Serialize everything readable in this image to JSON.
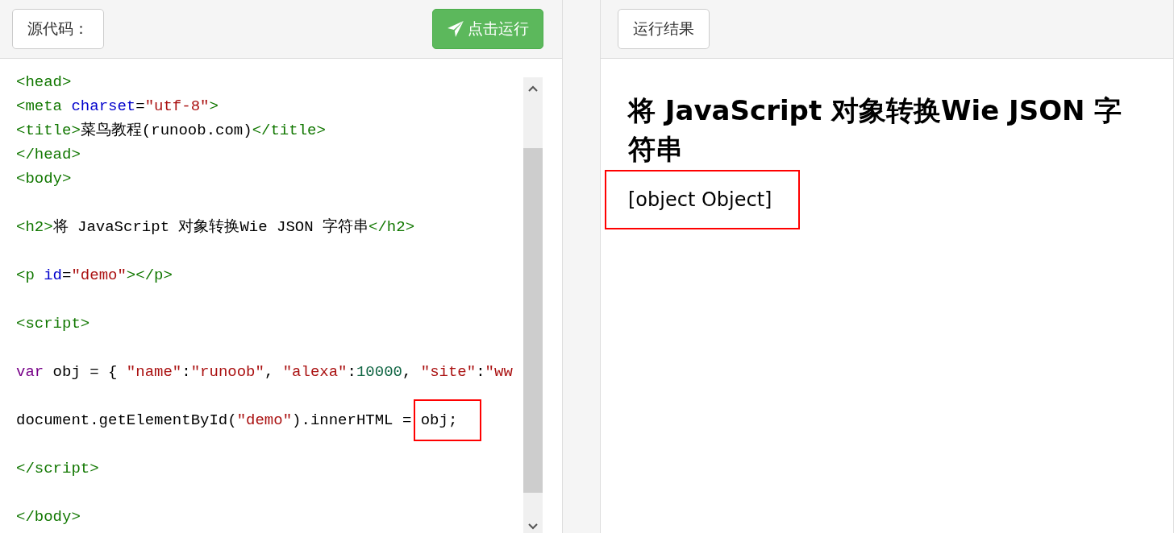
{
  "editor": {
    "label_button": "源代码：",
    "run_button": "点击运行",
    "lines": [
      {
        "kind": "code",
        "tokens": [
          {
            "kind": "tag",
            "text": "<head>"
          }
        ]
      },
      {
        "kind": "code",
        "tokens": [
          {
            "kind": "tag",
            "text": "<meta "
          },
          {
            "kind": "attr",
            "text": "charset"
          },
          {
            "kind": "plain",
            "text": "="
          },
          {
            "kind": "string",
            "text": "\"utf-8\""
          },
          {
            "kind": "tag",
            "text": ">"
          }
        ]
      },
      {
        "kind": "code",
        "tokens": [
          {
            "kind": "tag",
            "text": "<title>"
          },
          {
            "kind": "plain",
            "text": "菜鸟教程(runoob.com)"
          },
          {
            "kind": "tag",
            "text": "</title>"
          }
        ]
      },
      {
        "kind": "code",
        "tokens": [
          {
            "kind": "tag",
            "text": "</head>"
          }
        ]
      },
      {
        "kind": "code",
        "tokens": [
          {
            "kind": "tag",
            "text": "<body>"
          }
        ]
      },
      {
        "kind": "blank"
      },
      {
        "kind": "code",
        "tokens": [
          {
            "kind": "tag",
            "text": "<h2>"
          },
          {
            "kind": "plain",
            "text": "将 JavaScript 对象转换Wie JSON 字符串"
          },
          {
            "kind": "tag",
            "text": "</h2>"
          }
        ]
      },
      {
        "kind": "blank"
      },
      {
        "kind": "code",
        "tokens": [
          {
            "kind": "tag",
            "text": "<p "
          },
          {
            "kind": "attr",
            "text": "id"
          },
          {
            "kind": "plain",
            "text": "="
          },
          {
            "kind": "string",
            "text": "\"demo\""
          },
          {
            "kind": "tag",
            "text": "></p>"
          }
        ]
      },
      {
        "kind": "blank"
      },
      {
        "kind": "code",
        "tokens": [
          {
            "kind": "tag",
            "text": "<script>"
          }
        ]
      },
      {
        "kind": "blank"
      },
      {
        "kind": "code",
        "tokens": [
          {
            "kind": "keyword",
            "text": "var"
          },
          {
            "kind": "plain",
            "text": " obj = { "
          },
          {
            "kind": "string",
            "text": "\"name\""
          },
          {
            "kind": "plain",
            "text": ":"
          },
          {
            "kind": "string",
            "text": "\"runoob\""
          },
          {
            "kind": "plain",
            "text": ", "
          },
          {
            "kind": "string",
            "text": "\"alexa\""
          },
          {
            "kind": "plain",
            "text": ":"
          },
          {
            "kind": "number",
            "text": "10000"
          },
          {
            "kind": "plain",
            "text": ", "
          },
          {
            "kind": "string",
            "text": "\"site\""
          },
          {
            "kind": "plain",
            "text": ":"
          },
          {
            "kind": "string",
            "text": "\"ww"
          }
        ]
      },
      {
        "kind": "blank"
      },
      {
        "kind": "code",
        "tokens": [
          {
            "kind": "plain",
            "text": "document.getElementById("
          },
          {
            "kind": "string",
            "text": "\"demo\""
          },
          {
            "kind": "plain",
            "text": ").innerHTML = "
          },
          {
            "kind": "plain",
            "text": "obj;",
            "boxed": true
          }
        ]
      },
      {
        "kind": "blank"
      },
      {
        "kind": "code",
        "tokens": [
          {
            "kind": "tag",
            "text": "</script>"
          }
        ]
      },
      {
        "kind": "blank"
      },
      {
        "kind": "code",
        "tokens": [
          {
            "kind": "tag",
            "text": "</body>"
          }
        ]
      }
    ]
  },
  "result": {
    "label_button": "运行结果",
    "heading": "将 JavaScript 对象转换Wie JSON 字符串",
    "paragraph": {
      "text": "[object Object]",
      "boxed": true
    }
  }
}
